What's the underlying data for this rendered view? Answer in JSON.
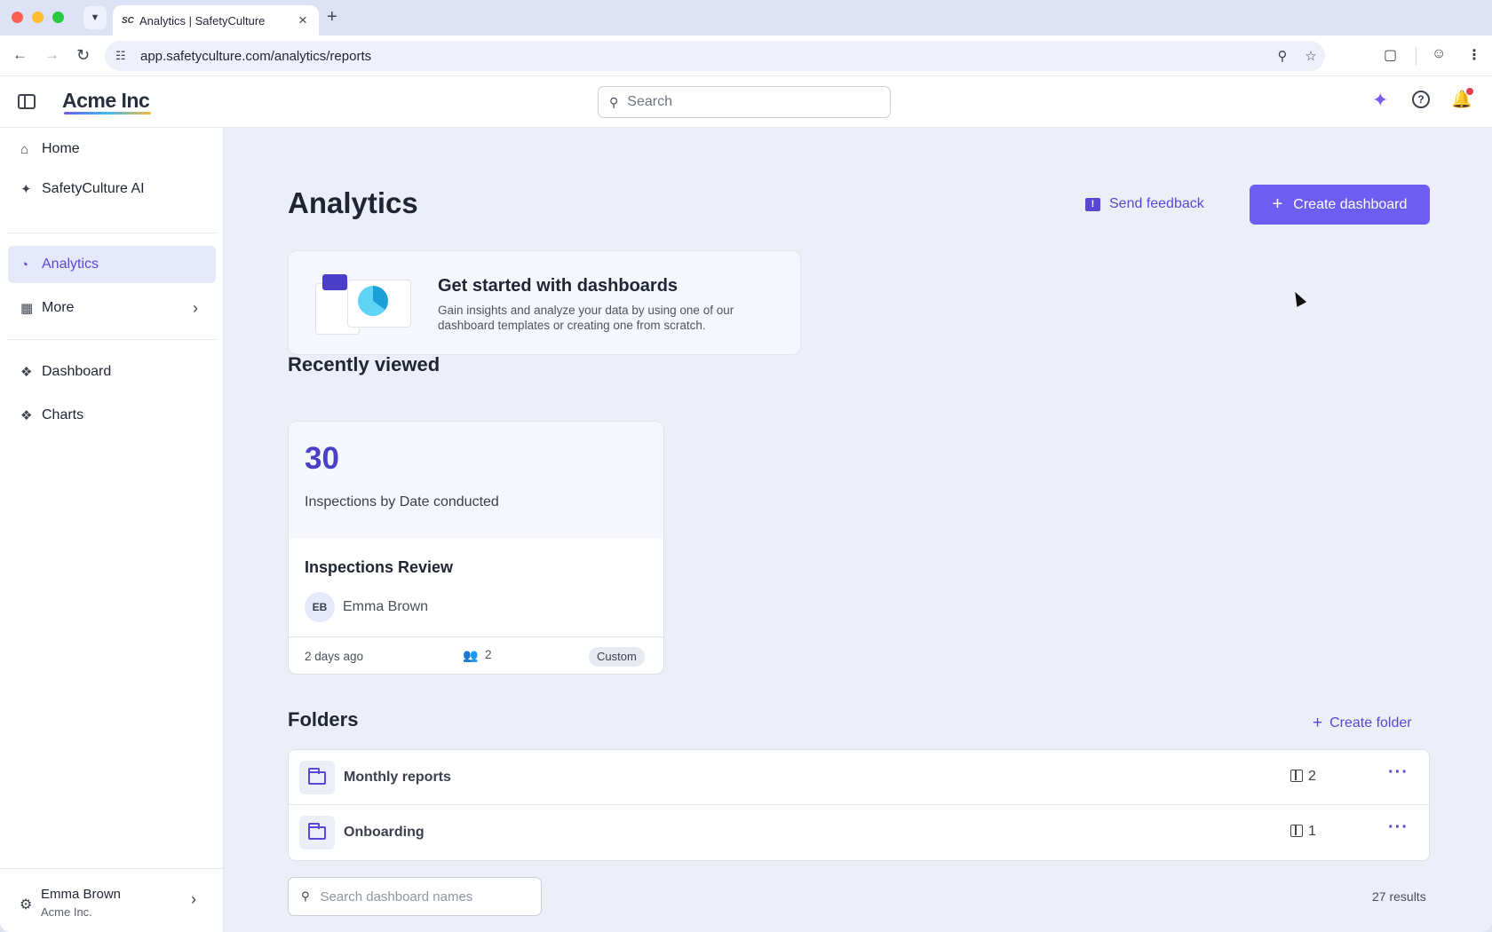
{
  "browser": {
    "tab_title": "Analytics | SafetyCulture",
    "tab_favicon": "SC",
    "url": "app.safetyculture.com/analytics/reports",
    "icons": [
      "back-arrow-icon",
      "forward-arrow-icon",
      "reload-icon",
      "site-settings-icon",
      "zoom-icon",
      "bookmark-star-icon",
      "extensions-icon",
      "profile-icon",
      "menu-dots-icon"
    ]
  },
  "header": {
    "logo": "Acme Inc",
    "search_placeholder": "Search"
  },
  "sidebar": {
    "items": [
      {
        "label": "Home",
        "icon": "home-icon"
      },
      {
        "label": "SafetyCulture AI",
        "icon": "sparkle-icon"
      },
      {
        "label": "Analytics",
        "icon": "pie-chart-icon",
        "active": true
      },
      {
        "label": "More",
        "icon": "grid-icon"
      },
      {
        "label": "Dashboard",
        "icon": "puzzle-icon"
      },
      {
        "label": "Charts",
        "icon": "puzzle-icon"
      }
    ],
    "user": {
      "name": "Emma Brown",
      "org": "Acme Inc."
    }
  },
  "main": {
    "title": "Analytics",
    "send_feedback": "Send feedback",
    "create_dashboard": "Create dashboard",
    "get_started": {
      "title": "Get started with dashboards",
      "description": "Gain insights and analyze your data by using one of our dashboard templates or creating one from scratch."
    },
    "recently_viewed": {
      "heading": "Recently viewed",
      "card": {
        "value": "30",
        "metric": "Inspections by Date conducted",
        "name": "Inspections Review",
        "owner_initials": "EB",
        "owner": "Emma Brown",
        "updated": "2 days ago",
        "shared_count": "2",
        "badge": "Custom"
      }
    },
    "folders": {
      "heading": "Folders",
      "create_folder": "Create folder",
      "items": [
        {
          "name": "Monthly reports",
          "count": "2"
        },
        {
          "name": "Onboarding",
          "count": "1"
        }
      ]
    },
    "dashboard_search_placeholder": "Search dashboard names",
    "results": "27 results"
  },
  "colors": {
    "accent": "#6d5df2",
    "accent_text": "#5b47d6",
    "page_bg": "#eceef8"
  }
}
